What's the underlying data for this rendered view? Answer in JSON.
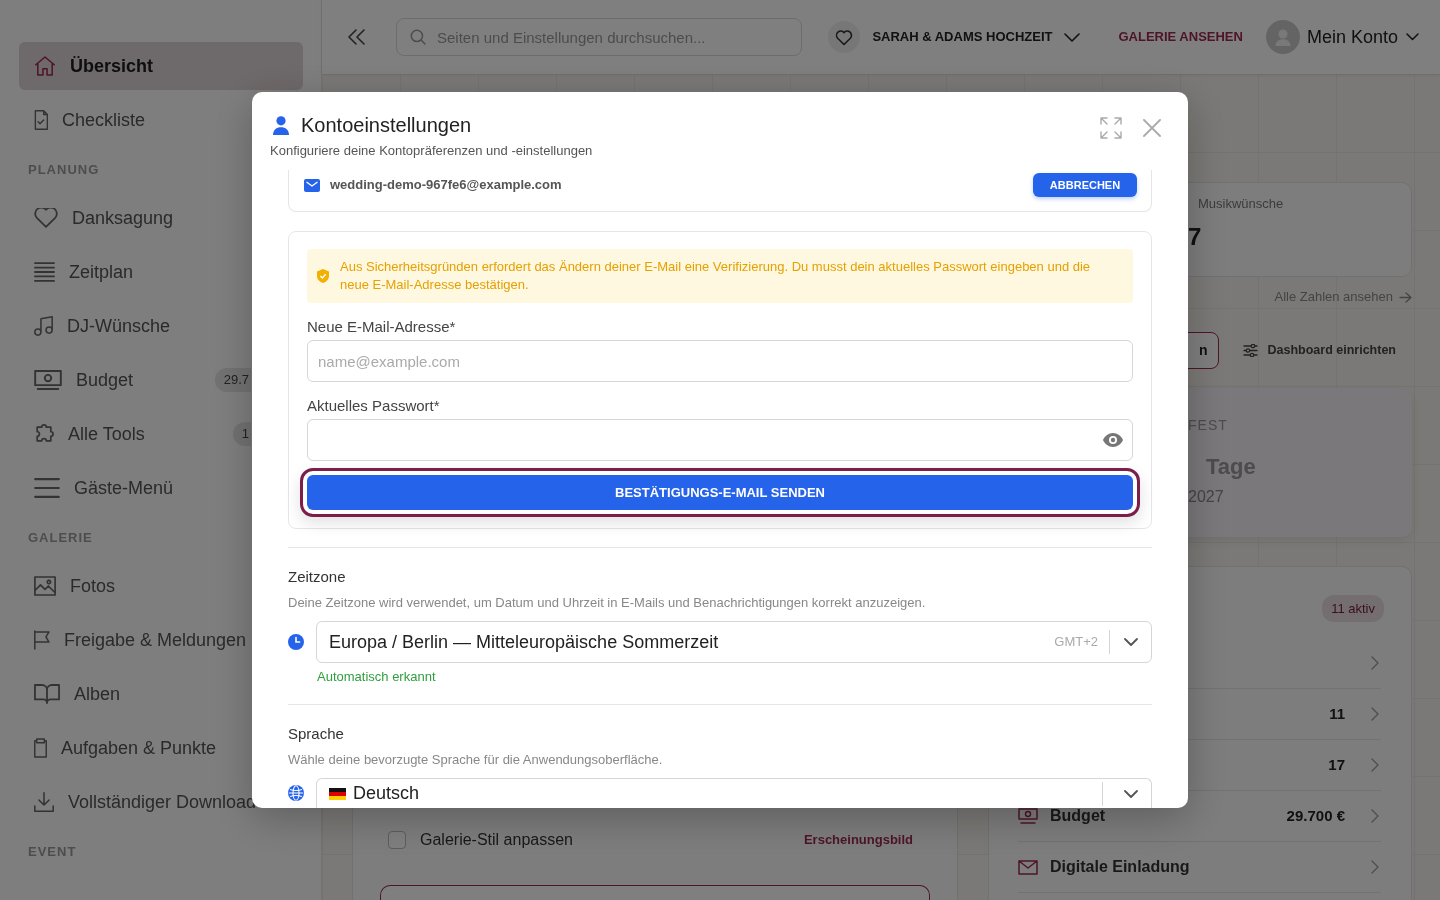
{
  "sidebar": {
    "groups": [
      {
        "items": [
          {
            "label": "Übersicht",
            "selected": true
          },
          {
            "label": "Checkliste",
            "selected": false
          }
        ]
      },
      {
        "heading": "PLANUNG",
        "items": [
          {
            "label": "Danksagung",
            "selected": false
          },
          {
            "label": "Zeitplan",
            "selected": false
          },
          {
            "label": "DJ-Wünsche",
            "selected": false
          },
          {
            "label": "Budget",
            "selected": false,
            "badge": "29.7"
          },
          {
            "label": "Alle Tools",
            "selected": false,
            "badge": "1"
          },
          {
            "label": "Gäste-Menü",
            "selected": false
          }
        ]
      },
      {
        "heading": "GALERIE",
        "items": [
          {
            "label": "Fotos",
            "selected": false
          },
          {
            "label": "Freigabe & Meldungen",
            "selected": false
          },
          {
            "label": "Alben",
            "selected": false
          },
          {
            "label": "Aufgaben & Punkte",
            "selected": false
          },
          {
            "label": "Vollständiger Download",
            "selected": false
          }
        ]
      },
      {
        "heading": "EVENT"
      }
    ]
  },
  "topbar": {
    "search": {
      "placeholder": "Seiten und Einstellungen durchsuchen..."
    },
    "event": "SARAH & ADAMS HOCHZEIT",
    "gallery_link": "GALERIE ANSEHEN",
    "account": "Mein Konto"
  },
  "dashboard": {
    "stat_card": {
      "label": "Musikwünsche",
      "value": "7"
    },
    "all_numbers_link": "Alle Zahlen ansehen",
    "buttons": [
      {
        "kind": "outline",
        "label": "n"
      },
      {
        "kind": "setup",
        "label": "Dashboard einrichten"
      }
    ],
    "countdown_card": {
      "heading": "FEST",
      "unit": "Tage",
      "date": "2027"
    },
    "checklist": {
      "items": [
        {
          "label": "Galerie-Stil anpassen",
          "checked": false,
          "tag": "Erscheinungsbild"
        }
      ]
    },
    "tools_card": {
      "badge": "11 aktiv",
      "rows": [
        {},
        {
          "value": "11"
        },
        {
          "value": "17"
        },
        {
          "label": "Budget",
          "value": "29.700 €"
        },
        {
          "label": "Digitale Einladung"
        }
      ]
    }
  },
  "modal": {
    "title": "Kontoeinstellungen",
    "subtitle": "Konfiguriere deine Kontopräferenzen und -einstellungen",
    "email_card": {
      "email": "wedding-demo-967fe6@example.com",
      "button": "ABBRECHEN"
    },
    "change_email": {
      "notice": "Aus Sicherheitsgründen erfordert das Ändern deiner E-Mail eine Verifizierung. Du musst dein aktuelles Passwort eingeben und die neue E-Mail-Adresse bestätigen.",
      "fields": [
        {
          "kind": "email",
          "label": "Neue E-Mail-Adresse*",
          "placeholder": "name@example.com"
        },
        {
          "kind": "password",
          "label": "Aktuelles Passwort*"
        }
      ],
      "submit": {
        "label": "BESTÄTIGUNGS-E-MAIL SENDEN",
        "focused": true
      }
    },
    "timezone": {
      "heading": "Zeitzone",
      "description": "Deine Zeitzone wird verwendet, um Datum und Uhrzeit in E-Mails und Benachrichtigungen korrekt anzuzeigen.",
      "value": "Europa / Berlin — Mitteleuropäische Sommerzeit",
      "offset": "GMT+2",
      "hint": "Automatisch erkannt"
    },
    "language": {
      "heading": "Sprache",
      "description": "Wähle deine bevorzugte Sprache für die Anwendungsoberfläche.",
      "value": "Deutsch"
    }
  }
}
